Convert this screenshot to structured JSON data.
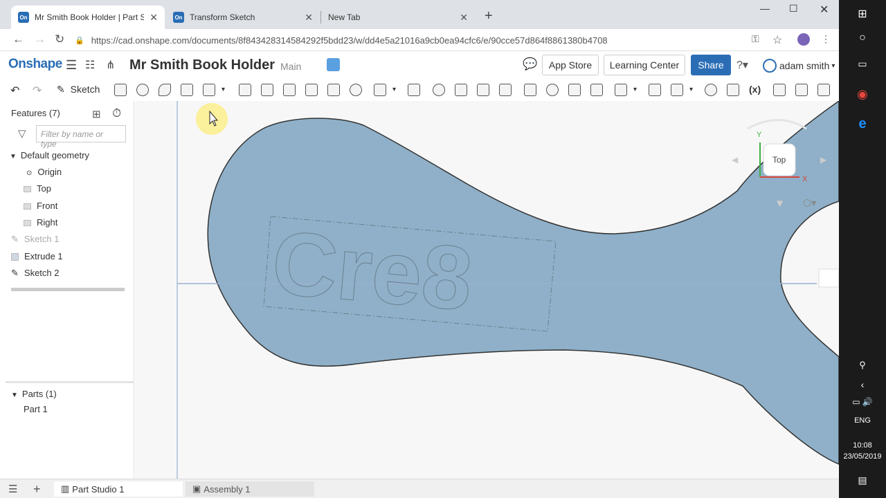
{
  "browser": {
    "tabs": [
      {
        "label": "Mr Smith Book Holder | Part Stud",
        "favicon": "On"
      },
      {
        "label": "Transform Sketch",
        "favicon": "On"
      },
      {
        "label": "New Tab"
      }
    ],
    "url": "https://cad.onshape.com/documents/8f843428314584292f5bdd23/w/dd4e5a21016a9cb0ea94cfc6/e/90cce57d864f8861380b4708"
  },
  "header": {
    "logo": "Onshape",
    "doc_title": "Mr Smith Book Holder",
    "branch": "Main",
    "app_store": "App Store",
    "learning_center": "Learning Center",
    "share": "Share",
    "user": "adam smith"
  },
  "toolbar": {
    "sketch": "Sketch"
  },
  "features": {
    "title": "Features (7)",
    "filter_placeholder": "Filter by name or type",
    "group": "Default geometry",
    "items": [
      "Origin",
      "Top",
      "Front",
      "Right",
      "Sketch 1",
      "Extrude 1",
      "Sketch 2"
    ]
  },
  "parts": {
    "title": "Parts (1)",
    "items": [
      "Part 1"
    ]
  },
  "viewport": {
    "text": "Cre8",
    "view_cube": "Top",
    "axis_x": "X",
    "axis_y": "Y"
  },
  "bottom_tabs": [
    "Part Studio 1",
    "Assembly 1"
  ],
  "system": {
    "language": "ENG",
    "time": "10:08",
    "date": "23/05/2019"
  },
  "colors": {
    "accent": "#2a6db5",
    "part": "#8fb0c8",
    "part_edge": "#333333"
  }
}
